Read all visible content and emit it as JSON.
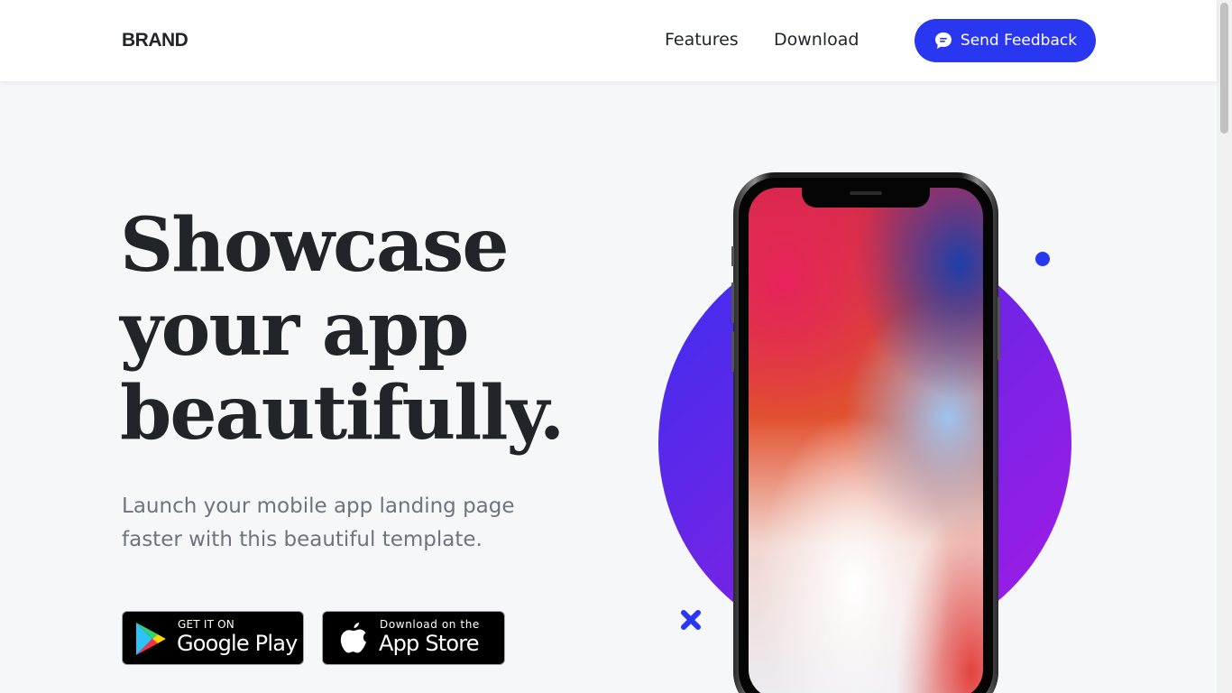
{
  "navbar": {
    "brand": "BRAND",
    "links": {
      "features": "Features",
      "download": "Download"
    },
    "feedback_button": {
      "label": "Send Feedback",
      "icon": "chat-bubble-icon"
    }
  },
  "hero": {
    "title_lines": [
      "Showcase",
      "your app",
      "beautifully."
    ],
    "subtitle": "Launch your mobile app landing page faster with this beautiful template."
  },
  "badges": {
    "google": {
      "small": "GET IT ON",
      "big": "Google Play",
      "icon": "google-play-icon"
    },
    "apple": {
      "small": "Download on the",
      "big": "App Store",
      "icon": "apple-icon"
    }
  },
  "colors": {
    "accent": "#2937f0",
    "circle_start": "#3a2ef2",
    "circle_end": "#a51be6",
    "text": "#212529",
    "muted": "#6c757d"
  }
}
